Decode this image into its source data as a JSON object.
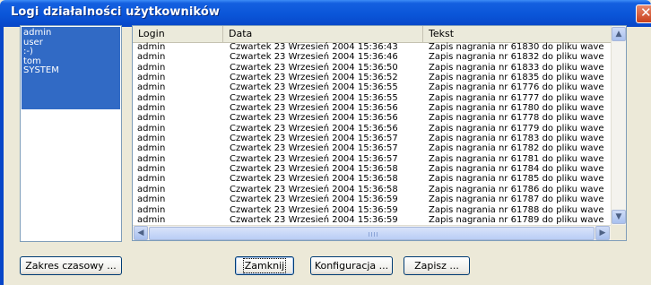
{
  "window": {
    "title": "Logi działalności użytkowników"
  },
  "users": [
    "admin",
    "user",
    ":-)",
    "tom",
    "SYSTEM"
  ],
  "table": {
    "columns": [
      "Login",
      "Data",
      "Tekst"
    ],
    "rows": [
      [
        "admin",
        "Czwartek 23 Wrzesień 2004 15:36:43",
        "Zapis nagrania nr 61830 do pliku wave"
      ],
      [
        "admin",
        "Czwartek 23 Wrzesień 2004 15:36:46",
        "Zapis nagrania nr 61832 do pliku wave"
      ],
      [
        "admin",
        "Czwartek 23 Wrzesień 2004 15:36:50",
        "Zapis nagrania nr 61833 do pliku wave"
      ],
      [
        "admin",
        "Czwartek 23 Wrzesień 2004 15:36:52",
        "Zapis nagrania nr 61835 do pliku wave"
      ],
      [
        "admin",
        "Czwartek 23 Wrzesień 2004 15:36:55",
        "Zapis nagrania nr 61776 do pliku wave"
      ],
      [
        "admin",
        "Czwartek 23 Wrzesień 2004 15:36:55",
        "Zapis nagrania nr 61777 do pliku wave"
      ],
      [
        "admin",
        "Czwartek 23 Wrzesień 2004 15:36:56",
        "Zapis nagrania nr 61780 do pliku wave"
      ],
      [
        "admin",
        "Czwartek 23 Wrzesień 2004 15:36:56",
        "Zapis nagrania nr 61778 do pliku wave"
      ],
      [
        "admin",
        "Czwartek 23 Wrzesień 2004 15:36:56",
        "Zapis nagrania nr 61779 do pliku wave"
      ],
      [
        "admin",
        "Czwartek 23 Wrzesień 2004 15:36:57",
        "Zapis nagrania nr 61783 do pliku wave"
      ],
      [
        "admin",
        "Czwartek 23 Wrzesień 2004 15:36:57",
        "Zapis nagrania nr 61782 do pliku wave"
      ],
      [
        "admin",
        "Czwartek 23 Wrzesień 2004 15:36:57",
        "Zapis nagrania nr 61781 do pliku wave"
      ],
      [
        "admin",
        "Czwartek 23 Wrzesień 2004 15:36:58",
        "Zapis nagrania nr 61784 do pliku wave"
      ],
      [
        "admin",
        "Czwartek 23 Wrzesień 2004 15:36:58",
        "Zapis nagrania nr 61785 do pliku wave"
      ],
      [
        "admin",
        "Czwartek 23 Wrzesień 2004 15:36:58",
        "Zapis nagrania nr 61786 do pliku wave"
      ],
      [
        "admin",
        "Czwartek 23 Wrzesień 2004 15:36:59",
        "Zapis nagrania nr 61787 do pliku wave"
      ],
      [
        "admin",
        "Czwartek 23 Wrzesień 2004 15:36:59",
        "Zapis nagrania nr 61788 do pliku wave"
      ],
      [
        "admin",
        "Czwartek 23 Wrzesień 2004 15:36:59",
        "Zapis nagrania nr 61789 do pliku wave"
      ]
    ]
  },
  "buttons": {
    "time_range": "Zakres czasowy ...",
    "close": "Zamknij",
    "config": "Konfiguracja ...",
    "save": "Zapisz ..."
  },
  "icons": {
    "close": "close-icon",
    "scroll_up": "arrow-up-icon",
    "scroll_down": "arrow-down-icon",
    "scroll_left": "arrow-left-icon",
    "scroll_right": "arrow-right-icon"
  },
  "colors": {
    "titlebar": "#0a55d8",
    "selection": "#316ac5",
    "dialog_bg": "#ece9d8"
  }
}
